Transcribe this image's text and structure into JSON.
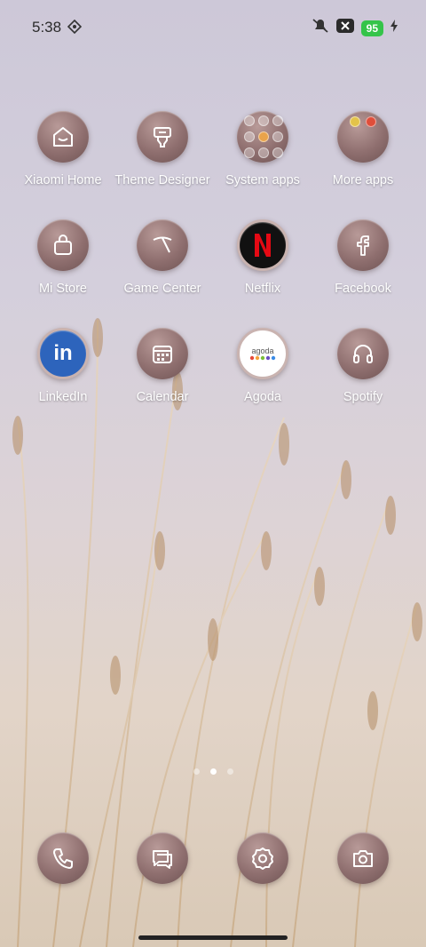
{
  "status": {
    "time": "5:38",
    "battery": "95"
  },
  "apps": [
    {
      "label": "Xiaomi Home",
      "icon": "xiaomi-home-icon"
    },
    {
      "label": "Theme Designer",
      "icon": "theme-designer-icon"
    },
    {
      "label": "System apps",
      "icon": "system-apps-folder-icon"
    },
    {
      "label": "More apps",
      "icon": "more-apps-folder-icon"
    },
    {
      "label": "Mi Store",
      "icon": "mi-store-icon"
    },
    {
      "label": "Game Center",
      "icon": "game-center-icon"
    },
    {
      "label": "Netflix",
      "icon": "netflix-icon"
    },
    {
      "label": "Facebook",
      "icon": "facebook-icon"
    },
    {
      "label": "LinkedIn",
      "icon": "linkedin-icon"
    },
    {
      "label": "Calendar",
      "icon": "calendar-icon"
    },
    {
      "label": "Agoda",
      "icon": "agoda-icon",
      "icon_text": "agoda"
    },
    {
      "label": "Spotify",
      "icon": "spotify-icon"
    }
  ],
  "dock": [
    {
      "icon": "phone-icon"
    },
    {
      "icon": "messages-icon"
    },
    {
      "icon": "settings-icon"
    },
    {
      "icon": "camera-icon"
    }
  ],
  "colors": {
    "icon_tint": "#8f6f6f",
    "battery_green": "#35c44a",
    "netflix_red": "#e50914",
    "linkedin_blue": "#2d64bc"
  }
}
